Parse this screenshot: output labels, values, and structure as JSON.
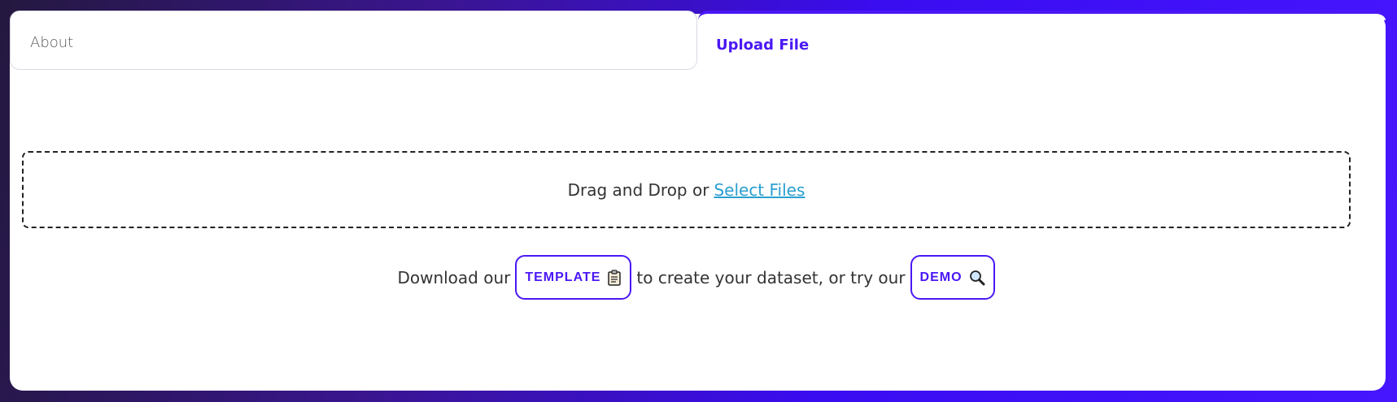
{
  "tabs": {
    "about_label": "About",
    "upload_label": "Upload File"
  },
  "dropzone": {
    "prefix": "Drag and Drop or",
    "select_label": "Select Files"
  },
  "download": {
    "prefix": "Download our",
    "template_label": "TEMPLATE",
    "middle": "to create your dataset, or try our",
    "demo_label": "DEMO"
  },
  "colors": {
    "accent": "#4a18f5",
    "link": "#2a9fd0",
    "text": "#333333"
  },
  "icons": {
    "template": "clipboard-icon",
    "demo": "magnifier-icon"
  }
}
